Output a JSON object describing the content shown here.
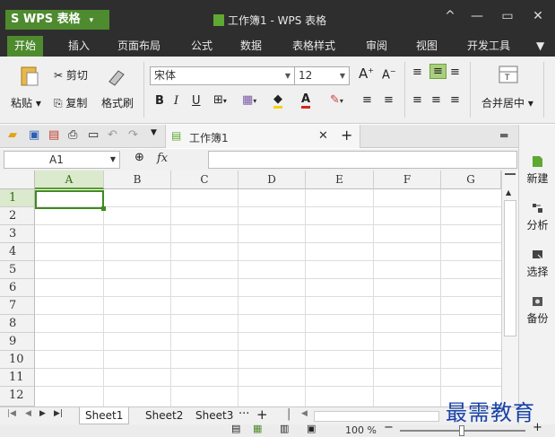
{
  "app": {
    "logo_text": "WPS 表格",
    "logo_arrow": "▾",
    "title": "工作簿1 - WPS 表格"
  },
  "window_controls": {
    "collapse": "^",
    "minimize": "—",
    "maximize": "▭",
    "close": "✕"
  },
  "menu": [
    "开始",
    "插入",
    "页面布局",
    "公式",
    "数据",
    "表格样式",
    "审阅",
    "视图",
    "开发工具"
  ],
  "ribbon": {
    "paste": "粘贴",
    "cut": "剪切",
    "copy": "复制",
    "format_painter": "格式刷",
    "font_name": "宋体",
    "font_size": "12",
    "bold": "B",
    "italic": "I",
    "underline": "U",
    "merge_center": "合并居中"
  },
  "quick_access": {
    "doc_tab": "工作簿1",
    "close": "✕",
    "add": "+"
  },
  "formula_bar": {
    "name_box": "A1",
    "fx": "fx",
    "value": ""
  },
  "columns": [
    "A",
    "B",
    "C",
    "D",
    "E",
    "F",
    "G"
  ],
  "rows": [
    "1",
    "2",
    "3",
    "4",
    "5",
    "6",
    "7",
    "8",
    "9",
    "10",
    "11",
    "12"
  ],
  "active_cell": "A1",
  "side_panel": [
    "新建",
    "分析",
    "选择",
    "备份"
  ],
  "sheets": {
    "tabs": [
      "Sheet1",
      "Sheet2",
      "Sheet3"
    ],
    "active": "Sheet1",
    "more": "···",
    "add": "+"
  },
  "status": {
    "zoom": "100 %"
  },
  "watermark": "最需教育",
  "colors": {
    "accent": "#4e8a2e",
    "titlebar": "#2e2e2e",
    "watermark": "#1a43a8"
  }
}
